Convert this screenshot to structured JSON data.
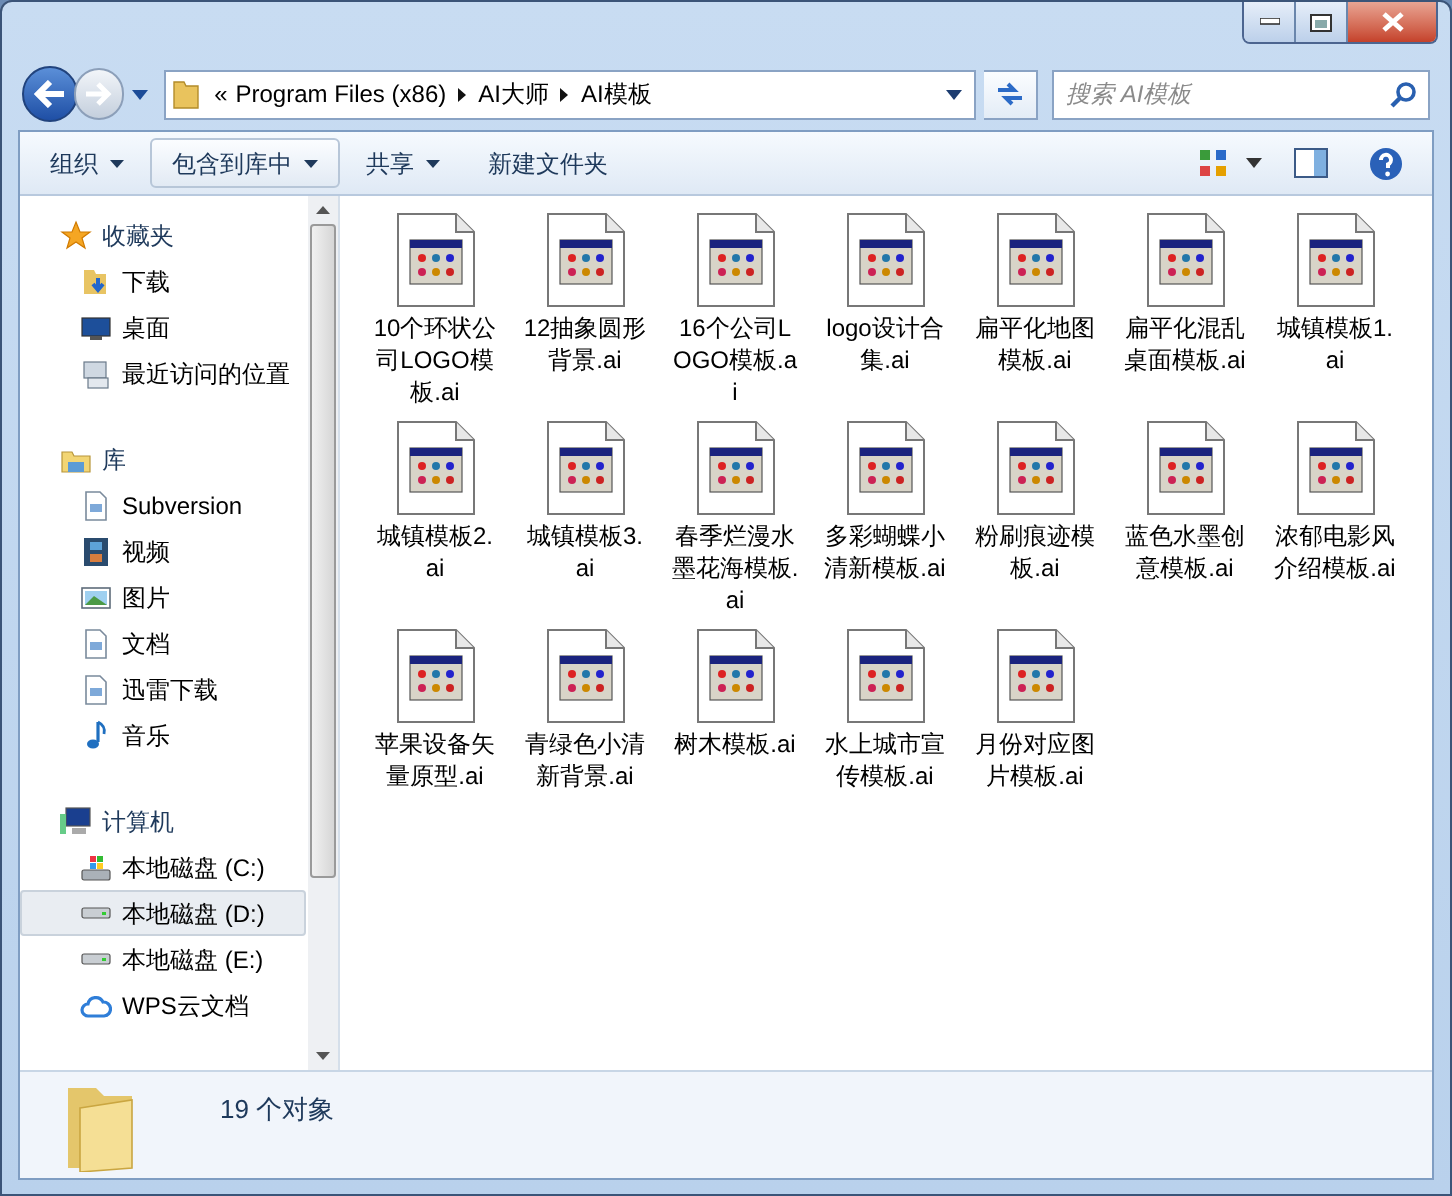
{
  "address": {
    "overflow": "«",
    "segments": [
      "Program Files (x86)",
      "AI大师",
      "AI模板"
    ]
  },
  "search": {
    "placeholder": "搜索 AI模板"
  },
  "toolbar": {
    "buttons": [
      {
        "label": "组织",
        "dropdown": true,
        "selected": false
      },
      {
        "label": "包含到库中",
        "dropdown": true,
        "selected": true
      },
      {
        "label": "共享",
        "dropdown": true,
        "selected": false
      },
      {
        "label": "新建文件夹",
        "dropdown": false,
        "selected": false
      }
    ]
  },
  "sidebar": {
    "groups": [
      {
        "label": "收藏夹",
        "kind": "star",
        "items": [
          {
            "label": "下载",
            "kind": "download",
            "selected": false
          },
          {
            "label": "桌面",
            "kind": "desktop",
            "selected": false
          },
          {
            "label": "最近访问的位置",
            "kind": "recent",
            "selected": false
          }
        ]
      },
      {
        "label": "库",
        "kind": "library",
        "items": [
          {
            "label": "Subversion",
            "kind": "doc",
            "selected": false
          },
          {
            "label": "视频",
            "kind": "video",
            "selected": false
          },
          {
            "label": "图片",
            "kind": "picture",
            "selected": false
          },
          {
            "label": "文档",
            "kind": "doc",
            "selected": false
          },
          {
            "label": "迅雷下载",
            "kind": "doc",
            "selected": false
          },
          {
            "label": "音乐",
            "kind": "music",
            "selected": false
          }
        ]
      },
      {
        "label": "计算机",
        "kind": "computer",
        "items": [
          {
            "label": "本地磁盘 (C:)",
            "kind": "system-drive",
            "selected": false
          },
          {
            "label": "本地磁盘 (D:)",
            "kind": "drive",
            "selected": true
          },
          {
            "label": "本地磁盘 (E:)",
            "kind": "drive",
            "selected": false
          },
          {
            "label": "WPS云文档",
            "kind": "cloud",
            "selected": false
          }
        ]
      }
    ]
  },
  "files": [
    {
      "name": "10个环状公司LOGO模板.ai"
    },
    {
      "name": "12抽象圆形背景.ai"
    },
    {
      "name": "16个公司LOGO模板.ai"
    },
    {
      "name": "logo设计合集.ai"
    },
    {
      "name": "扁平化地图模板.ai"
    },
    {
      "name": "扁平化混乱桌面模板.ai"
    },
    {
      "name": "城镇模板1.ai"
    },
    {
      "name": "城镇模板2.ai"
    },
    {
      "name": "城镇模板3.ai"
    },
    {
      "name": "春季烂漫水墨花海模板.ai"
    },
    {
      "name": "多彩蝴蝶小清新模板.ai"
    },
    {
      "name": "粉刷痕迹模板.ai"
    },
    {
      "name": "蓝色水墨创意模板.ai"
    },
    {
      "name": "浓郁电影风介绍模板.ai"
    },
    {
      "name": "苹果设备矢量原型.ai"
    },
    {
      "name": "青绿色小清新背景.ai"
    },
    {
      "name": "树木模板.ai"
    },
    {
      "name": "水上城市宣传模板.ai"
    },
    {
      "name": "月份对应图片模板.ai"
    }
  ],
  "status_bar": {
    "text": "19 个对象"
  }
}
